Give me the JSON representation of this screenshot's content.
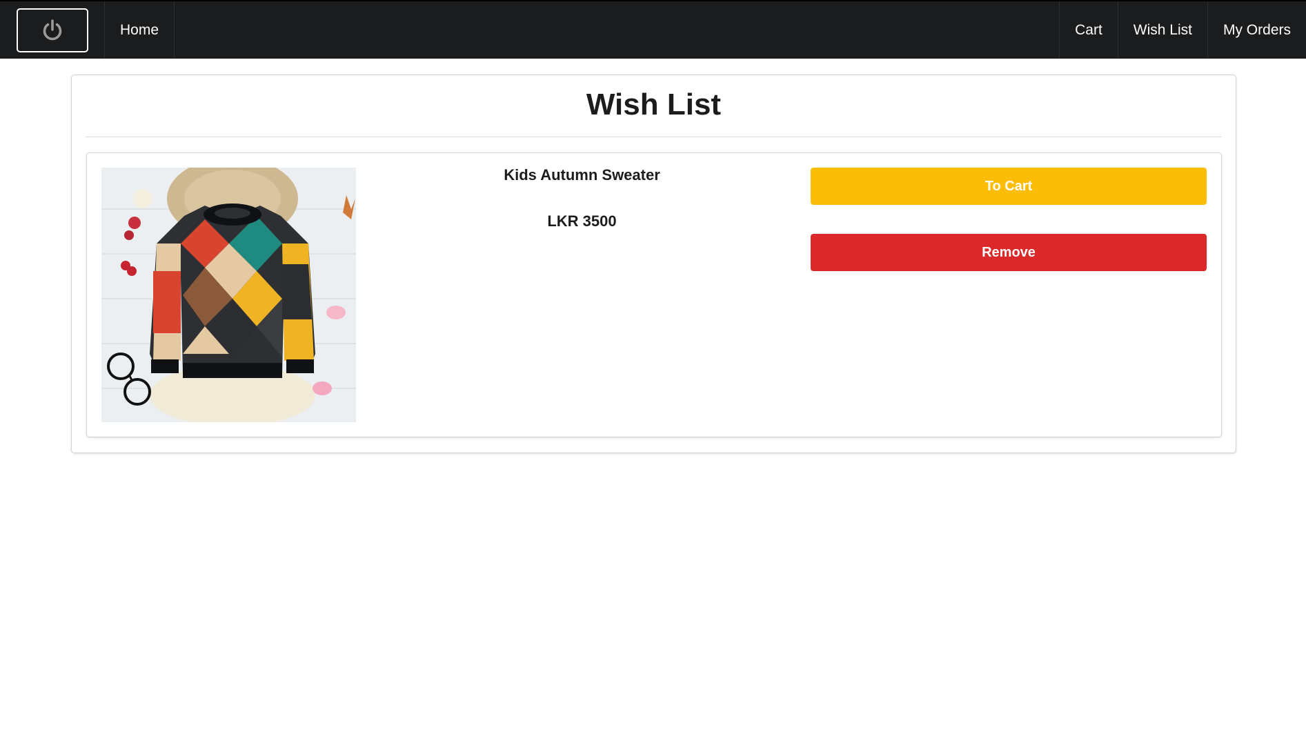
{
  "navbar": {
    "power_icon": "power-icon",
    "home_label": "Home",
    "cart_label": "Cart",
    "wishlist_label": "Wish List",
    "orders_label": "My Orders"
  },
  "page": {
    "title": "Wish List"
  },
  "items": [
    {
      "name": "Kids Autumn Sweater",
      "price": "LKR 3500",
      "image": "sweater-product-image",
      "to_cart_label": "To Cart",
      "remove_label": "Remove"
    }
  ],
  "colors": {
    "navbar_bg": "#1b1c1d",
    "to_cart_button": "#fbbd08",
    "remove_button": "#db2828"
  }
}
